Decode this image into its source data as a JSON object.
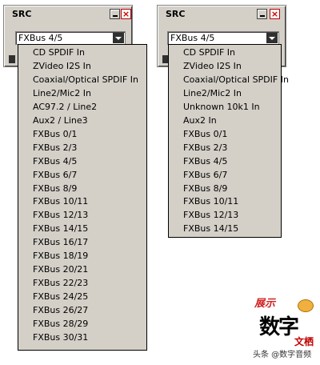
{
  "left_window": {
    "title": "SRC",
    "selected": "FXBus 4/5",
    "items": [
      "CD SPDIF In",
      "ZVideo I2S In",
      "Coaxial/Optical SPDIF In",
      "Line2/Mic2 In",
      "AC97.2 / Line2",
      "Aux2 / Line3",
      "FXBus 0/1",
      "FXBus 2/3",
      "FXBus 4/5",
      "FXBus 6/7",
      "FXBus 8/9",
      "FXBus 10/11",
      "FXBus 12/13",
      "FXBus 14/15",
      "FXBus 16/17",
      "FXBus 18/19",
      "FXBus 20/21",
      "FXBus 22/23",
      "FXBus 24/25",
      "FXBus 26/27",
      "FXBus 28/29",
      "FXBus 30/31"
    ]
  },
  "right_window": {
    "title": "SRC",
    "selected": "FXBus 4/5",
    "items": [
      "CD SPDIF In",
      "ZVideo I2S In",
      "Coaxial/Optical SPDIF In",
      "Line2/Mic2 In",
      "Unknown 10k1 In",
      "Aux2 In",
      "FXBus 0/1",
      "FXBus 2/3",
      "FXBus 4/5",
      "FXBus 6/7",
      "FXBus 8/9",
      "FXBus 10/11",
      "FXBus 12/13",
      "FXBus 14/15"
    ]
  },
  "watermark": {
    "top": "展示",
    "big": "数字",
    "side": "文栖",
    "caption": "头条 @数字音频"
  }
}
